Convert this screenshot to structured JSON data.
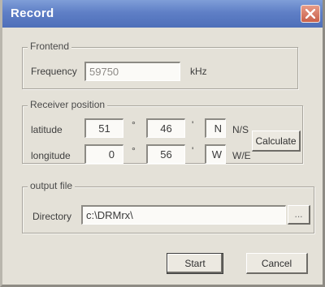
{
  "window": {
    "title": "Record"
  },
  "frontend": {
    "legend": "Frontend",
    "frequency_label": "Frequency",
    "frequency_value": "59750",
    "unit": "kHz"
  },
  "receiver": {
    "legend": "Receiver position",
    "latitude_label": "latitude",
    "lat_deg": "51",
    "lat_min": "46",
    "lat_dir": "N",
    "lat_dir_hint": "N/S",
    "longitude_label": "longitude",
    "lon_deg": "0",
    "lon_min": "56",
    "lon_dir": "W",
    "lon_dir_hint": "W/E",
    "degree_mark": "°",
    "minute_mark": "'",
    "calculate_label": "Calculate"
  },
  "output": {
    "legend": "output file",
    "directory_label": "Directory",
    "directory_value": "c:\\DRMrx\\",
    "browse_label": "..."
  },
  "buttons": {
    "start": "Start",
    "cancel": "Cancel"
  }
}
